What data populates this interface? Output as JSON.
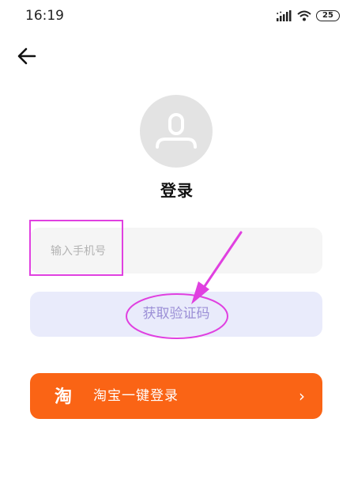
{
  "status_bar": {
    "time": "16:19",
    "battery": "25"
  },
  "login": {
    "title": "登录",
    "phone_placeholder": "输入手机号",
    "verify_label": "获取验证码",
    "taobao_label": "淘宝一键登录",
    "taobao_logo_text": "淘",
    "taobao_chevron": "›"
  },
  "colors": {
    "taobao_orange": "#fa6415",
    "verify_bg": "#e9ebfb",
    "verify_text": "#9b8fd6",
    "annotation_magenta": "#e040e0"
  },
  "icons": [
    "back-arrow-icon",
    "avatar-icon",
    "signal-icon",
    "wifi-icon",
    "battery-icon",
    "taobao-logo-icon",
    "chevron-right-icon"
  ]
}
